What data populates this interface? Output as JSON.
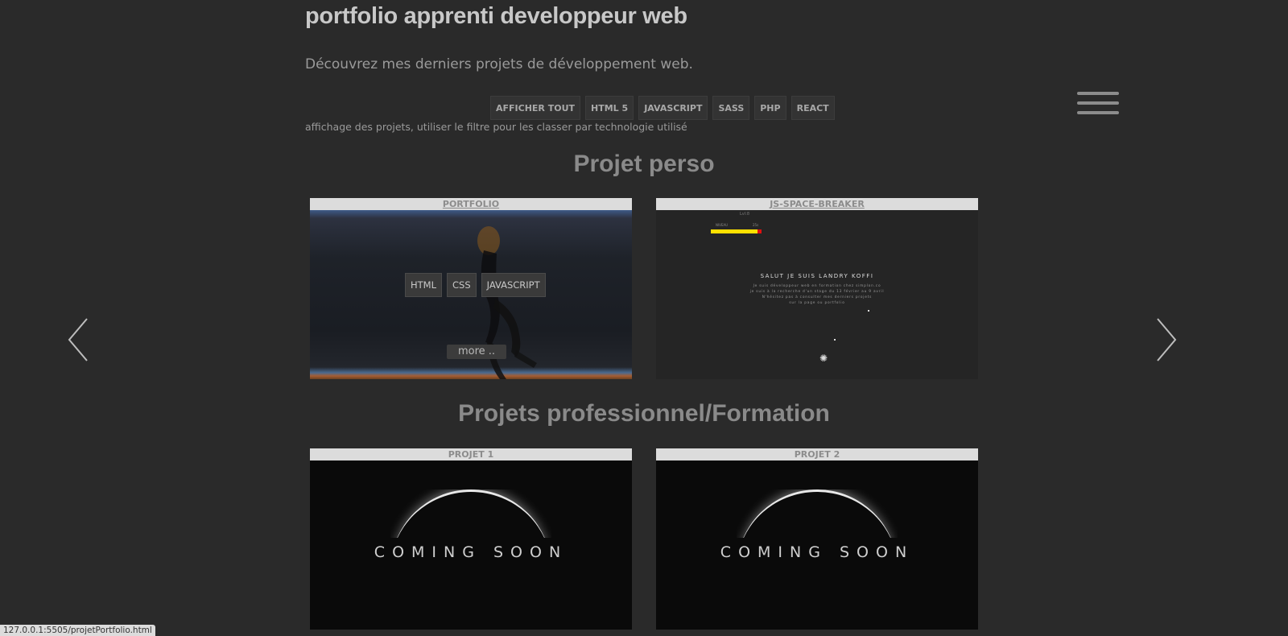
{
  "header": {
    "title": "portfolio apprenti developpeur web",
    "subtitle": "Découvrez mes derniers projets de développement web."
  },
  "filters": [
    "AFFICHER TOUT",
    "HTML 5",
    "JAVASCRIPT",
    "SASS",
    "PHP",
    "REACT"
  ],
  "info_text": "affichage des projets, utiliser le filtre pour les classer par technologie utilisé",
  "sections": {
    "perso_title": "Projet perso",
    "pro_title": "Projets professionnel/Formation"
  },
  "cards": {
    "portfolio": {
      "title": "PORTFOLIO",
      "tags": [
        "HTML",
        "CSS",
        "JAVASCRIPT"
      ],
      "more": "more .."
    },
    "space_breaker": {
      "title": "JS-SPACE-BREAKER",
      "game_label": "Lvl:8",
      "hud_left": "NIVEAU",
      "hud_right": "25s",
      "headline": "SALUT JE SUIS LANDRY KOFFI",
      "lines": [
        "Je suis développeur web en formation chez simplon.co",
        "je suis à la recherche d'un stage du 13 février au 9 avril",
        "N'hésitez pas à consulter mes derniers projets",
        "sur la page ou    portfolio"
      ]
    },
    "projet1": {
      "title": "PROJET 1",
      "text": "COMING SOON"
    },
    "projet2": {
      "title": "PROJET 2",
      "text": "COMING SOON"
    }
  },
  "status_bar": {
    "url": "127.0.0.1:5505/projetPortfolio.html"
  },
  "icons": {
    "menu": "hamburger-icon",
    "prev": "chevron-left-icon",
    "next": "chevron-right-icon"
  },
  "colors": {
    "background": "#2a2a2a",
    "card_header": "#dcdcdc",
    "hp_yellow": "#ffe000",
    "hp_red": "#e01010"
  }
}
